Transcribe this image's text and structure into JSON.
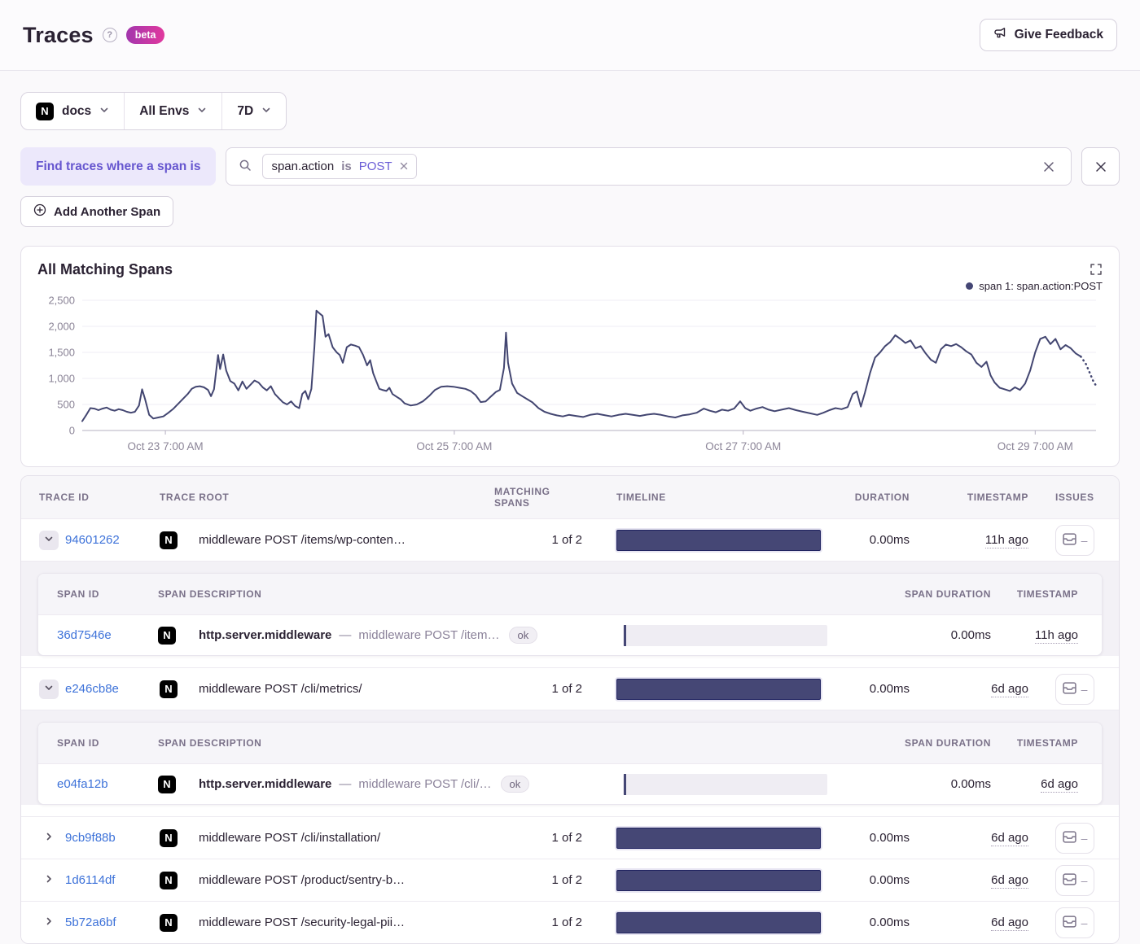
{
  "header": {
    "title": "Traces",
    "beta_label": "beta",
    "feedback_label": "Give Feedback"
  },
  "icons": {
    "project_logo_letter": "N",
    "help_glyph": "?"
  },
  "filters": {
    "project_label": "docs",
    "env_label": "All Envs",
    "period_label": "7D",
    "find_label": "Find traces where a span is",
    "token": {
      "key": "span.action",
      "op": "is",
      "value": "POST"
    },
    "add_span_label": "Add Another Span"
  },
  "chart_data": {
    "type": "line",
    "title": "All Matching Spans",
    "ylim": [
      0,
      2500
    ],
    "grid": true,
    "legend_position": "top-right",
    "line_color": "#434671",
    "dotted_tail": 5,
    "yticks": [
      {
        "v": 0,
        "label": "0"
      },
      {
        "v": 500,
        "label": "500"
      },
      {
        "v": 1000,
        "label": "1,000"
      },
      {
        "v": 1500,
        "label": "1,500"
      },
      {
        "v": 2000,
        "label": "2,000"
      },
      {
        "v": 2500,
        "label": "2,500"
      }
    ],
    "xticks": [
      {
        "pos": 0.082,
        "label": "Oct 23 7:00 AM"
      },
      {
        "pos": 0.367,
        "label": "Oct 25 7:00 AM"
      },
      {
        "pos": 0.652,
        "label": "Oct 27 7:00 AM"
      },
      {
        "pos": 0.94,
        "label": "Oct 29 7:00 AM"
      }
    ],
    "series": [
      {
        "name": "span 1: span.action:POST",
        "points": [
          [
            0,
            180
          ],
          [
            0.004,
            300
          ],
          [
            0.008,
            430
          ],
          [
            0.012,
            420
          ],
          [
            0.016,
            390
          ],
          [
            0.02,
            420
          ],
          [
            0.024,
            440
          ],
          [
            0.028,
            400
          ],
          [
            0.032,
            380
          ],
          [
            0.036,
            410
          ],
          [
            0.04,
            390
          ],
          [
            0.044,
            360
          ],
          [
            0.048,
            340
          ],
          [
            0.052,
            360
          ],
          [
            0.056,
            480
          ],
          [
            0.059,
            790
          ],
          [
            0.062,
            600
          ],
          [
            0.066,
            300
          ],
          [
            0.07,
            230
          ],
          [
            0.075,
            250
          ],
          [
            0.08,
            270
          ],
          [
            0.085,
            340
          ],
          [
            0.09,
            420
          ],
          [
            0.095,
            520
          ],
          [
            0.1,
            620
          ],
          [
            0.104,
            700
          ],
          [
            0.108,
            800
          ],
          [
            0.112,
            840
          ],
          [
            0.116,
            850
          ],
          [
            0.12,
            830
          ],
          [
            0.124,
            780
          ],
          [
            0.127,
            660
          ],
          [
            0.13,
            790
          ],
          [
            0.134,
            1450
          ],
          [
            0.136,
            1180
          ],
          [
            0.139,
            1460
          ],
          [
            0.142,
            1150
          ],
          [
            0.146,
            950
          ],
          [
            0.15,
            900
          ],
          [
            0.154,
            770
          ],
          [
            0.158,
            940
          ],
          [
            0.162,
            800
          ],
          [
            0.166,
            880
          ],
          [
            0.17,
            960
          ],
          [
            0.174,
            920
          ],
          [
            0.178,
            830
          ],
          [
            0.182,
            770
          ],
          [
            0.186,
            850
          ],
          [
            0.19,
            700
          ],
          [
            0.194,
            620
          ],
          [
            0.198,
            540
          ],
          [
            0.202,
            500
          ],
          [
            0.206,
            560
          ],
          [
            0.21,
            470
          ],
          [
            0.214,
            430
          ],
          [
            0.217,
            700
          ],
          [
            0.22,
            760
          ],
          [
            0.223,
            600
          ],
          [
            0.226,
            800
          ],
          [
            0.229,
            1600
          ],
          [
            0.231,
            2300
          ],
          [
            0.234,
            2250
          ],
          [
            0.237,
            2200
          ],
          [
            0.24,
            1800
          ],
          [
            0.243,
            1850
          ],
          [
            0.247,
            1600
          ],
          [
            0.251,
            1500
          ],
          [
            0.254,
            1450
          ],
          [
            0.257,
            1300
          ],
          [
            0.261,
            1600
          ],
          [
            0.265,
            1650
          ],
          [
            0.269,
            1630
          ],
          [
            0.273,
            1600
          ],
          [
            0.277,
            1450
          ],
          [
            0.281,
            1250
          ],
          [
            0.284,
            1350
          ],
          [
            0.287,
            1100
          ],
          [
            0.29,
            950
          ],
          [
            0.293,
            800
          ],
          [
            0.296,
            780
          ],
          [
            0.3,
            760
          ],
          [
            0.303,
            820
          ],
          [
            0.306,
            700
          ],
          [
            0.31,
            650
          ],
          [
            0.314,
            600
          ],
          [
            0.318,
            520
          ],
          [
            0.324,
            480
          ],
          [
            0.33,
            500
          ],
          [
            0.336,
            560
          ],
          [
            0.342,
            660
          ],
          [
            0.348,
            780
          ],
          [
            0.354,
            840
          ],
          [
            0.36,
            850
          ],
          [
            0.366,
            840
          ],
          [
            0.372,
            820
          ],
          [
            0.378,
            800
          ],
          [
            0.383,
            760
          ],
          [
            0.388,
            680
          ],
          [
            0.393,
            545
          ],
          [
            0.398,
            560
          ],
          [
            0.403,
            650
          ],
          [
            0.408,
            740
          ],
          [
            0.412,
            780
          ],
          [
            0.416,
            1200
          ],
          [
            0.418,
            1880
          ],
          [
            0.42,
            1300
          ],
          [
            0.424,
            900
          ],
          [
            0.429,
            720
          ],
          [
            0.434,
            660
          ],
          [
            0.439,
            600
          ],
          [
            0.444,
            540
          ],
          [
            0.45,
            430
          ],
          [
            0.456,
            360
          ],
          [
            0.462,
            320
          ],
          [
            0.468,
            290
          ],
          [
            0.474,
            270
          ],
          [
            0.48,
            300
          ],
          [
            0.487,
            280
          ],
          [
            0.494,
            260
          ],
          [
            0.501,
            300
          ],
          [
            0.508,
            320
          ],
          [
            0.515,
            295
          ],
          [
            0.522,
            270
          ],
          [
            0.529,
            300
          ],
          [
            0.536,
            320
          ],
          [
            0.543,
            300
          ],
          [
            0.55,
            280
          ],
          [
            0.557,
            305
          ],
          [
            0.564,
            320
          ],
          [
            0.571,
            300
          ],
          [
            0.578,
            270
          ],
          [
            0.585,
            250
          ],
          [
            0.592,
            290
          ],
          [
            0.599,
            310
          ],
          [
            0.606,
            340
          ],
          [
            0.613,
            420
          ],
          [
            0.619,
            380
          ],
          [
            0.625,
            350
          ],
          [
            0.631,
            400
          ],
          [
            0.637,
            380
          ],
          [
            0.643,
            420
          ],
          [
            0.649,
            560
          ],
          [
            0.654,
            430
          ],
          [
            0.659,
            380
          ],
          [
            0.665,
            420
          ],
          [
            0.671,
            450
          ],
          [
            0.677,
            400
          ],
          [
            0.683,
            370
          ],
          [
            0.69,
            400
          ],
          [
            0.697,
            430
          ],
          [
            0.704,
            390
          ],
          [
            0.711,
            360
          ],
          [
            0.718,
            330
          ],
          [
            0.725,
            300
          ],
          [
            0.731,
            340
          ],
          [
            0.737,
            390
          ],
          [
            0.743,
            430
          ],
          [
            0.749,
            410
          ],
          [
            0.755,
            450
          ],
          [
            0.76,
            700
          ],
          [
            0.764,
            750
          ],
          [
            0.768,
            460
          ],
          [
            0.772,
            720
          ],
          [
            0.777,
            1100
          ],
          [
            0.782,
            1400
          ],
          [
            0.787,
            1500
          ],
          [
            0.792,
            1620
          ],
          [
            0.797,
            1700
          ],
          [
            0.802,
            1830
          ],
          [
            0.807,
            1760
          ],
          [
            0.812,
            1680
          ],
          [
            0.817,
            1730
          ],
          [
            0.822,
            1580
          ],
          [
            0.827,
            1620
          ],
          [
            0.832,
            1480
          ],
          [
            0.837,
            1360
          ],
          [
            0.842,
            1300
          ],
          [
            0.847,
            1560
          ],
          [
            0.852,
            1650
          ],
          [
            0.857,
            1620
          ],
          [
            0.862,
            1660
          ],
          [
            0.867,
            1600
          ],
          [
            0.872,
            1520
          ],
          [
            0.877,
            1460
          ],
          [
            0.882,
            1300
          ],
          [
            0.887,
            1220
          ],
          [
            0.892,
            1320
          ],
          [
            0.896,
            1060
          ],
          [
            0.9,
            920
          ],
          [
            0.905,
            820
          ],
          [
            0.91,
            790
          ],
          [
            0.915,
            760
          ],
          [
            0.92,
            830
          ],
          [
            0.925,
            780
          ],
          [
            0.93,
            900
          ],
          [
            0.935,
            1150
          ],
          [
            0.94,
            1500
          ],
          [
            0.945,
            1760
          ],
          [
            0.95,
            1800
          ],
          [
            0.955,
            1660
          ],
          [
            0.96,
            1760
          ],
          [
            0.965,
            1560
          ],
          [
            0.97,
            1640
          ],
          [
            0.975,
            1580
          ],
          [
            0.98,
            1480
          ],
          [
            0.985,
            1420
          ],
          [
            0.99,
            1280
          ],
          [
            0.994,
            1100
          ],
          [
            0.997,
            960
          ],
          [
            1,
            860
          ]
        ]
      }
    ]
  },
  "table": {
    "columns": [
      "TRACE ID",
      "TRACE ROOT",
      "MATCHING SPANS",
      "TIMELINE",
      "DURATION",
      "TIMESTAMP",
      "ISSUES"
    ],
    "sub_columns": [
      "SPAN ID",
      "SPAN DESCRIPTION",
      "SPAN DURATION",
      "TIMESTAMP"
    ],
    "separator": "—",
    "issues_dash": "–",
    "rows": [
      {
        "type": "trace",
        "expanded": true,
        "trace_id": "94601262",
        "root": "middleware POST /items/wp-conten…",
        "matching": "1 of 2",
        "duration": "0.00ms",
        "timestamp": "11h ago"
      },
      {
        "type": "spans",
        "spans": [
          {
            "span_id": "36d7546e",
            "op": "http.server.middleware",
            "description": "middleware POST /item…",
            "status": "ok",
            "duration": "0.00ms",
            "timestamp": "11h ago"
          }
        ]
      },
      {
        "type": "trace",
        "expanded": true,
        "trace_id": "e246cb8e",
        "root": "middleware POST /cli/metrics/",
        "matching": "1 of 2",
        "duration": "0.00ms",
        "timestamp": "6d ago"
      },
      {
        "type": "spans",
        "spans": [
          {
            "span_id": "e04fa12b",
            "op": "http.server.middleware",
            "description": "middleware POST /cli/…",
            "status": "ok",
            "duration": "0.00ms",
            "timestamp": "6d ago"
          }
        ]
      },
      {
        "type": "trace",
        "expanded": false,
        "trace_id": "9cb9f88b",
        "root": "middleware POST /cli/installation/",
        "matching": "1 of 2",
        "duration": "0.00ms",
        "timestamp": "6d ago"
      },
      {
        "type": "trace",
        "expanded": false,
        "trace_id": "1d6114df",
        "root": "middleware POST /product/sentry-b…",
        "matching": "1 of 2",
        "duration": "0.00ms",
        "timestamp": "6d ago"
      },
      {
        "type": "trace",
        "expanded": false,
        "trace_id": "5b72a6bf",
        "root": "middleware POST /security-legal-pii…",
        "matching": "1 of 2",
        "duration": "0.00ms",
        "timestamp": "6d ago"
      }
    ]
  }
}
